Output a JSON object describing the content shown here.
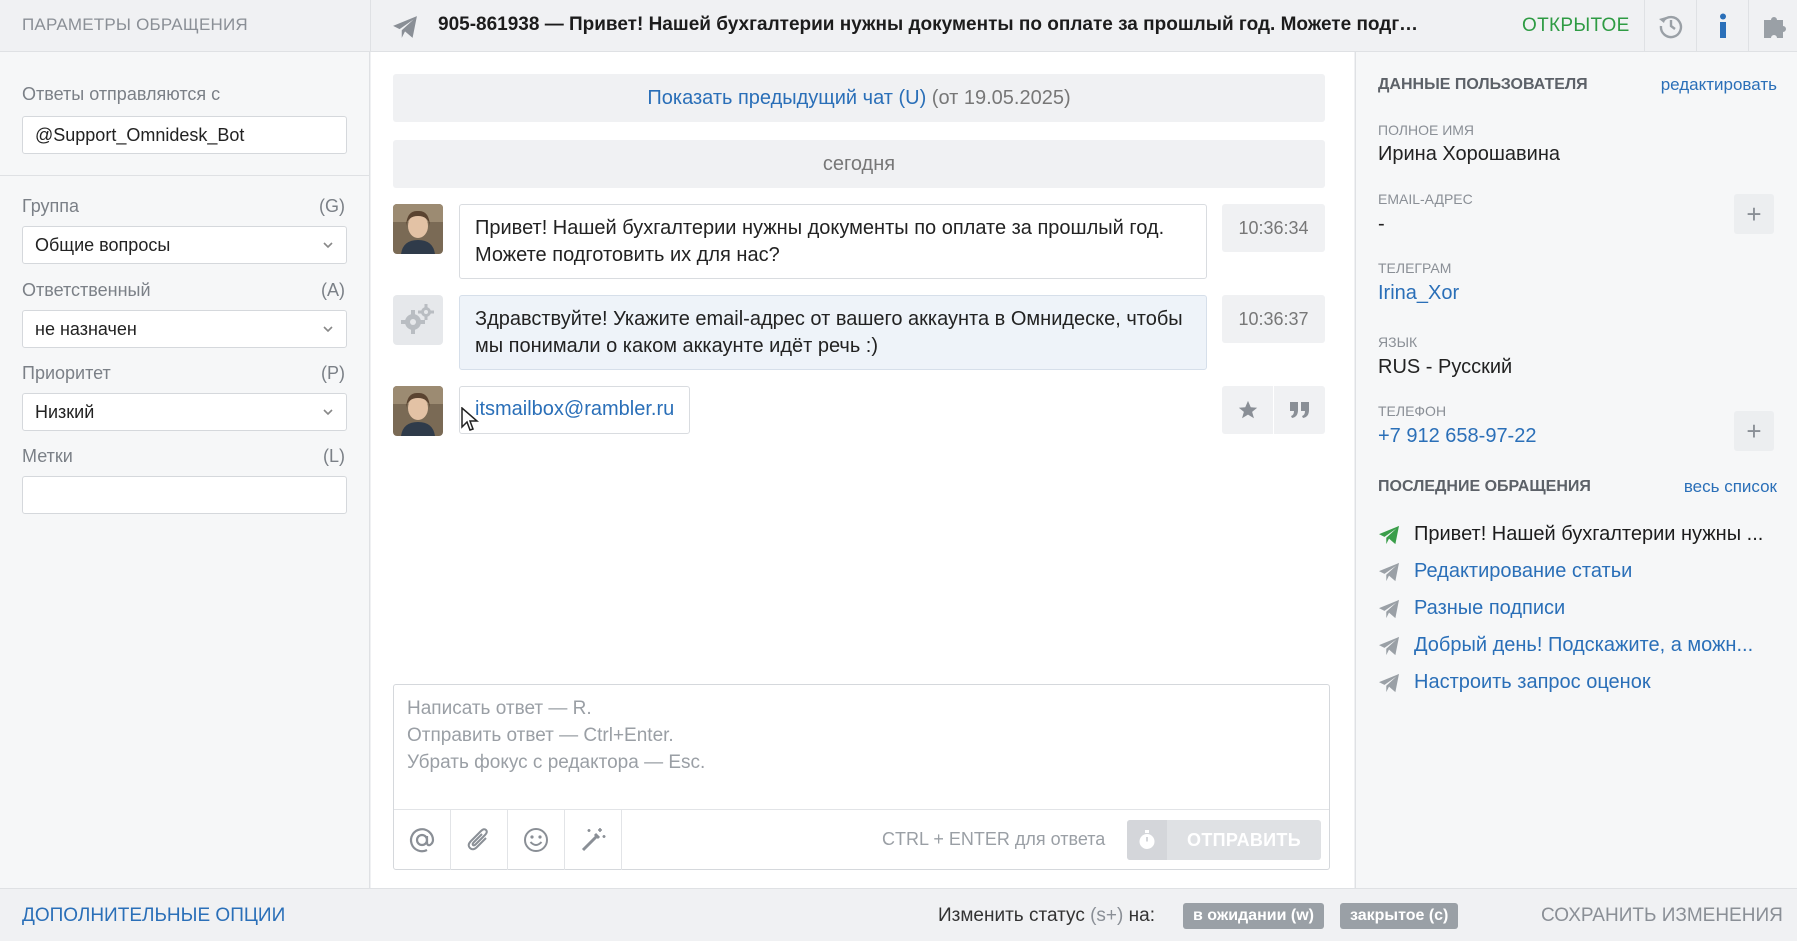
{
  "header": {
    "left_title": "Параметры обращения",
    "subject": "905-861938 — Привет! Нашей бухгалтерии нужны документы по оплате за прошлый год. Можете подгот...",
    "status": "Открытое",
    "icons": [
      "history-icon",
      "info-icon",
      "puzzle-icon"
    ]
  },
  "left": {
    "replies_from_label": "Ответы отправляются с",
    "replies_from_value": "@Support_Omnidesk_Bot",
    "group": {
      "label": "Группа",
      "hotkey": "(G)",
      "value": "Общие вопросы"
    },
    "assignee": {
      "label": "Ответственный",
      "hotkey": "(A)",
      "value": "не назначен"
    },
    "priority": {
      "label": "Приоритет",
      "hotkey": "(P)",
      "value": "Низкий"
    },
    "tags": {
      "label": "Метки",
      "hotkey": "(L)",
      "value": ""
    }
  },
  "chat": {
    "prev_chat_link": "Показать предыдущий чат (U)",
    "prev_chat_date": " (от 19.05.2025)",
    "today_label": "сегодня",
    "messages": [
      {
        "from": "user",
        "text": "Привет! Нашей бухгалтерии нужны документы по оплате за прошлый год. Можете подготовить их для нас?",
        "time": "10:36:34"
      },
      {
        "from": "agent",
        "text": "Здравствуйте! Укажите email-адрес от вашего аккаунта в Омнидеске, чтобы мы понимали о каком аккаунте идёт речь :)",
        "time": "10:36:37"
      },
      {
        "from": "user",
        "text": "itsmailbox@rambler.ru",
        "time": ""
      }
    ],
    "editor_placeholder": [
      "Написать ответ — R.",
      "Отправить ответ — Ctrl+Enter.",
      "Убрать фокус с редактора — Esc."
    ],
    "send_hint": "CTRL + ENTER для ответа",
    "send_label": "Отправить"
  },
  "right": {
    "user_data_title": "Данные пользователя",
    "edit_link": "редактировать",
    "full_name_label": "Полное имя",
    "full_name": "Ирина Хорошавина",
    "email_label": "Email-адрес",
    "email": "-",
    "telegram_label": "Телеграм",
    "telegram": "Irina_Xor",
    "language_label": "Язык",
    "language": "RUS - Русский",
    "phone_label": "Телефон",
    "phone": "+7 912 658-97-22",
    "recent_title": "Последние обращения",
    "all_list_link": "весь список",
    "recent": [
      {
        "text": "Привет! Нашей бухгалтерии нужны ...",
        "current": true
      },
      {
        "text": "Редактирование статьи",
        "current": false
      },
      {
        "text": "Разные подписи",
        "current": false
      },
      {
        "text": "Добрый день! Подскажите, а можн...",
        "current": false
      },
      {
        "text": "Настроить запрос оценок",
        "current": false
      }
    ]
  },
  "footer": {
    "more_options": "Дополнительные опции",
    "change_status_prefix": "Изменить статус ",
    "change_status_key": "(s+)",
    "change_status_suffix": " на:",
    "status_waiting": "в ожидании (w)",
    "status_closed": "закрытое (c)",
    "save_changes": "Сохранить изменения"
  },
  "colors": {
    "accent_link": "#2a6fb8",
    "status_open": "#2e9b43",
    "telegram_green": "#3a9e4a",
    "telegram_gray": "#9aa0a6"
  }
}
